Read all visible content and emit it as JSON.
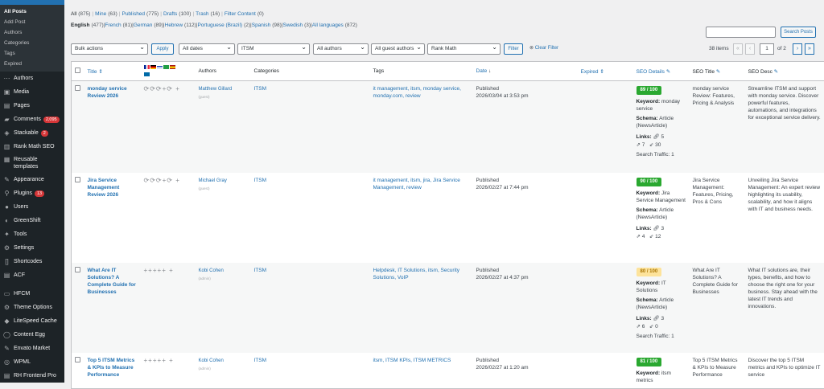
{
  "sidebar": {
    "submenu": [
      "All Posts",
      "Add Post",
      "Authors",
      "Categories",
      "Tags",
      "Expired"
    ],
    "items": [
      {
        "label": "Authors",
        "icon": "dots-icon"
      },
      {
        "label": "Media",
        "icon": "media-icon"
      },
      {
        "label": "Pages",
        "icon": "pages-icon"
      },
      {
        "label": "Comments",
        "icon": "comments-icon",
        "badge": "2,095"
      },
      {
        "label": "Stackable",
        "icon": "stackable-icon",
        "badge": "2"
      },
      {
        "label": "Rank Math SEO",
        "icon": "rankmath-icon"
      },
      {
        "label": "Reusable",
        "label2": "templates",
        "icon": "reusable-icon"
      },
      {
        "label": "Appearance",
        "icon": "appearance-icon"
      },
      {
        "label": "Plugins",
        "icon": "plugins-icon",
        "badge": "13"
      },
      {
        "label": "Users",
        "icon": "users-icon"
      },
      {
        "label": "GreenShift",
        "icon": "greenshift-icon"
      },
      {
        "label": "Tools",
        "icon": "tools-icon"
      },
      {
        "label": "Settings",
        "icon": "settings-icon"
      },
      {
        "label": "Shortcodes",
        "icon": "shortcodes-icon"
      },
      {
        "label": "ACF",
        "icon": "acf-icon"
      },
      {
        "label": "HFCM",
        "icon": "hfcm-icon"
      },
      {
        "label": "Theme Options",
        "icon": "theme-options-icon"
      },
      {
        "label": "LiteSpeed Cache",
        "icon": "litespeed-icon"
      },
      {
        "label": "Content Egg",
        "icon": "content-egg-icon"
      },
      {
        "label": "Envato Market",
        "icon": "envato-icon"
      },
      {
        "label": "WPML",
        "icon": "wpml-icon"
      },
      {
        "label": "RH Frontend Pro",
        "icon": "rh-frontend-icon"
      }
    ]
  },
  "views": [
    {
      "label": "All",
      "count": "(875)"
    },
    {
      "label": "Mine",
      "count": "(63)"
    },
    {
      "label": "Published",
      "count": "(775)"
    },
    {
      "label": "Drafts",
      "count": "(100)"
    },
    {
      "label": "Trash",
      "count": "(16)"
    },
    {
      "label": "Filter Content",
      "count": "(0)"
    }
  ],
  "languages": [
    {
      "label": "English",
      "count": "(477)"
    },
    {
      "label": "French",
      "count": "(81)"
    },
    {
      "label": "German",
      "count": "(89)"
    },
    {
      "label": "Hebrew",
      "count": "(112)"
    },
    {
      "label": "Portuguese (Brazil)",
      "count": "(2)"
    },
    {
      "label": "Spanish",
      "count": "(98)"
    },
    {
      "label": "Swedish",
      "count": "(3)"
    },
    {
      "label": "All languages",
      "count": "(872)"
    }
  ],
  "search": {
    "button": "Search Posts",
    "value": ""
  },
  "filters": {
    "bulk": "Bulk actions",
    "apply": "Apply",
    "dates": "All dates",
    "category": "ITSM",
    "authors": "All authors",
    "guest": "All guest authors",
    "seo": "Rank Math",
    "filter": "Filter",
    "clear": "Clear Filter"
  },
  "pagination": {
    "items": "38 items",
    "first": "«",
    "prev": "‹",
    "current": "1",
    "of": "of 2",
    "next": "›",
    "last": "»"
  },
  "columns": {
    "title": "Title",
    "authors": "Authors",
    "categories": "Categories",
    "tags": "Tags",
    "date": "Date",
    "expired": "Expired",
    "seo_details": "SEO Details",
    "seo_title": "SEO Title",
    "seo_desc": "SEO Desc"
  },
  "colors": {
    "accent": "#2271b1",
    "good": "#2aa830",
    "ok": "#fde39b"
  },
  "rows": [
    {
      "title": "monday service Review 2026",
      "author": "Matthew Gillard",
      "author_note": "(guest)",
      "category": "ITSM",
      "tags": "it management, itsm, monday service, monday.com, review",
      "status": "Published",
      "date": "2026/03/04 at 3:53 pm",
      "score": "89 / 100",
      "score_class": "green",
      "keyword_label": "Keyword:",
      "keyword": "monday service",
      "schema_label": "Schema:",
      "schema": "Article (NewsArticle)",
      "links_label": "Links:",
      "int_links": "5",
      "ext_links": "7",
      "inc_links": "30",
      "traffic": "Search Traffic: 1",
      "seo_title": "monday service Review: Features, Pricing & Analysis",
      "seo_desc": "Streamline ITSM and support with monday service. Discover powerful features, automations, and integrations for exceptional service delivery.",
      "translations": "⟳⟳⟳+⟳ +"
    },
    {
      "title": "Jira Service Management Review 2026",
      "author": "Michael Gray",
      "author_note": "(guest)",
      "category": "ITSM",
      "tags": "it management, itsm, jira, Jira Service Management, review",
      "status": "Published",
      "date": "2026/02/27 at 7:44 pm",
      "score": "90 / 100",
      "score_class": "green",
      "keyword_label": "Keyword:",
      "keyword": "Jira Service Management",
      "schema_label": "Schema:",
      "schema": "Article (NewsArticle)",
      "links_label": "Links:",
      "int_links": "3",
      "ext_links": "4",
      "inc_links": "12",
      "traffic": "",
      "seo_title": "Jira Service Management: Features, Pricing, Pros & Cons",
      "seo_desc": "Unveiling Jira Service Management: An expert review highlighting its usability, scalability, and how it aligns with IT and business needs.",
      "translations": "⟳⟳⟳+⟳ +"
    },
    {
      "title": "What Are IT Solutions? A Complete Guide for Businesses",
      "author": "Kobi Cohen",
      "author_note": "(admin)",
      "category": "ITSM",
      "tags": "Helpdesk, IT Solutions, itsm, Security Solutions, VoIP",
      "status": "Published",
      "date": "2026/02/27 at 4:37 pm",
      "score": "80 / 100",
      "score_class": "yellow",
      "keyword_label": "Keyword:",
      "keyword": "IT Solutions",
      "schema_label": "Schema:",
      "schema": "Article (NewsArticle)",
      "links_label": "Links:",
      "int_links": "3",
      "ext_links": "6",
      "inc_links": "0",
      "traffic": "Search Traffic: 1",
      "seo_title": "What Are IT Solutions? A Complete Guide for Businesses",
      "seo_desc": "What IT solutions are, their types, benefits, and how to choose the right one for your business. Stay ahead with the latest IT trends and innovations.",
      "translations": "+++++ +"
    },
    {
      "title": "Top 5 ITSM Metrics & KPIs to Measure Performance",
      "author": "Kobi Cohen",
      "author_note": "(admin)",
      "category": "ITSM",
      "tags": "itsm, ITSM KPIs, ITSM METRICS",
      "status": "Published",
      "date": "2026/02/27 at 1:20 am",
      "score": "81 / 100",
      "score_class": "green",
      "keyword_label": "Keyword:",
      "keyword": "itsm metrics",
      "schema_label": "",
      "schema": "",
      "links_label": "",
      "int_links": "",
      "ext_links": "",
      "inc_links": "",
      "traffic": "",
      "seo_title": "Top 5 ITSM Metrics & KPIs to Measure Performance",
      "seo_desc": "Discover the top 5 ITSM metrics and KPIs to optimize IT service",
      "translations": "+++++ +"
    }
  ]
}
